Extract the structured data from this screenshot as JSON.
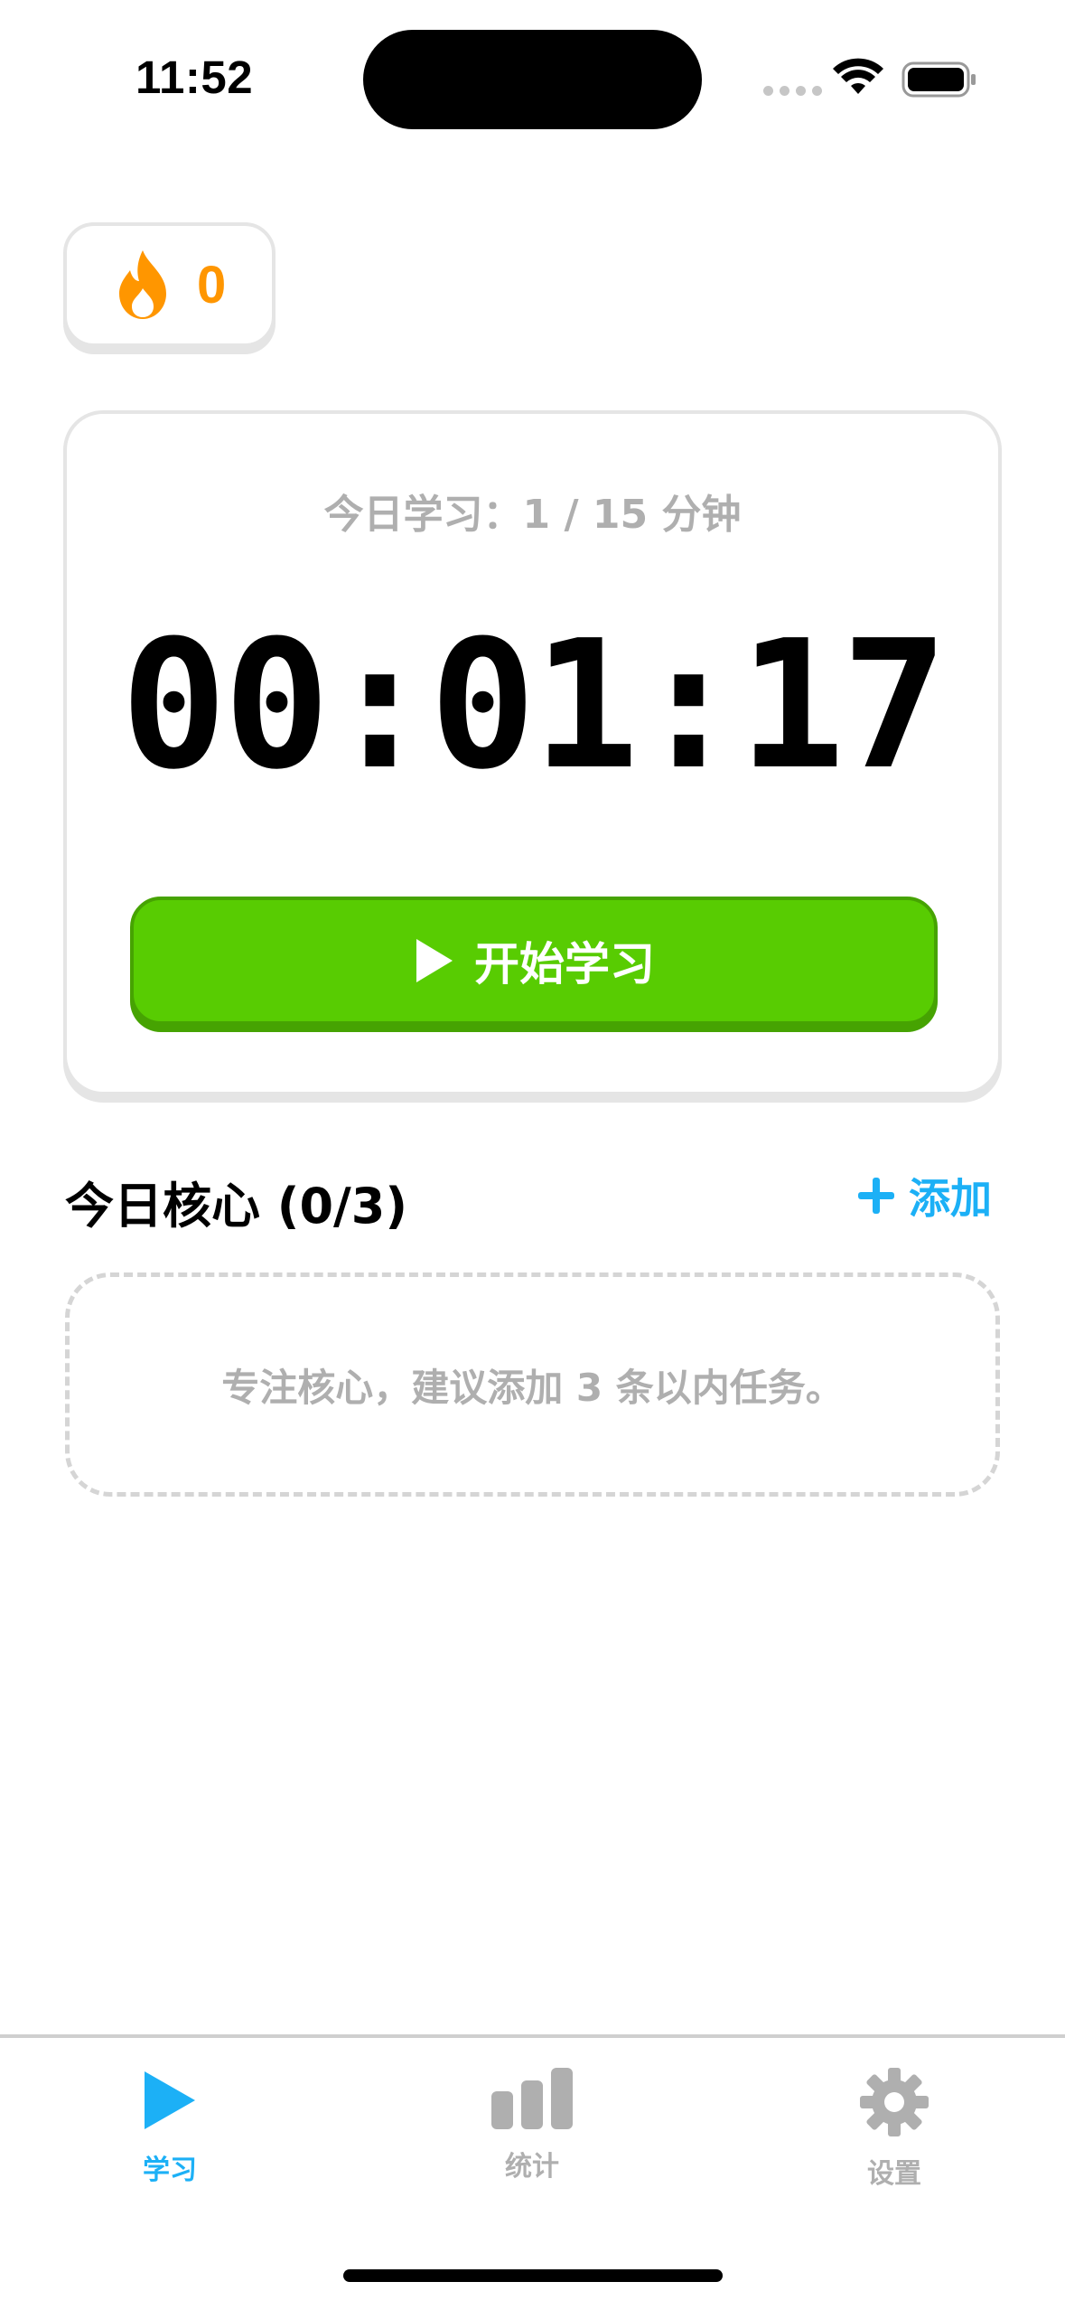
{
  "status_bar": {
    "time": "11:52"
  },
  "streak": {
    "count": "0",
    "icon": "flame-icon",
    "color": "#ff9600"
  },
  "timer_card": {
    "today_progress": "今日学习：1 / 15 分钟",
    "time": "00:01:17",
    "start_button_label": "开始学习",
    "start_button_color": "#58cc02"
  },
  "core_tasks": {
    "title": "今日核心 (0/3)",
    "add_label": "添加",
    "accent_color": "#1cb0f6",
    "empty_message": "专注核心，建议添加 3 条以内任务。"
  },
  "tab_bar": {
    "tabs": [
      {
        "label": "学习",
        "icon": "play-icon",
        "active": true
      },
      {
        "label": "统计",
        "icon": "bar-chart-icon",
        "active": false
      },
      {
        "label": "设置",
        "icon": "gear-icon",
        "active": false
      }
    ],
    "active_color": "#1cb0f6",
    "inactive_color": "#afafaf"
  }
}
